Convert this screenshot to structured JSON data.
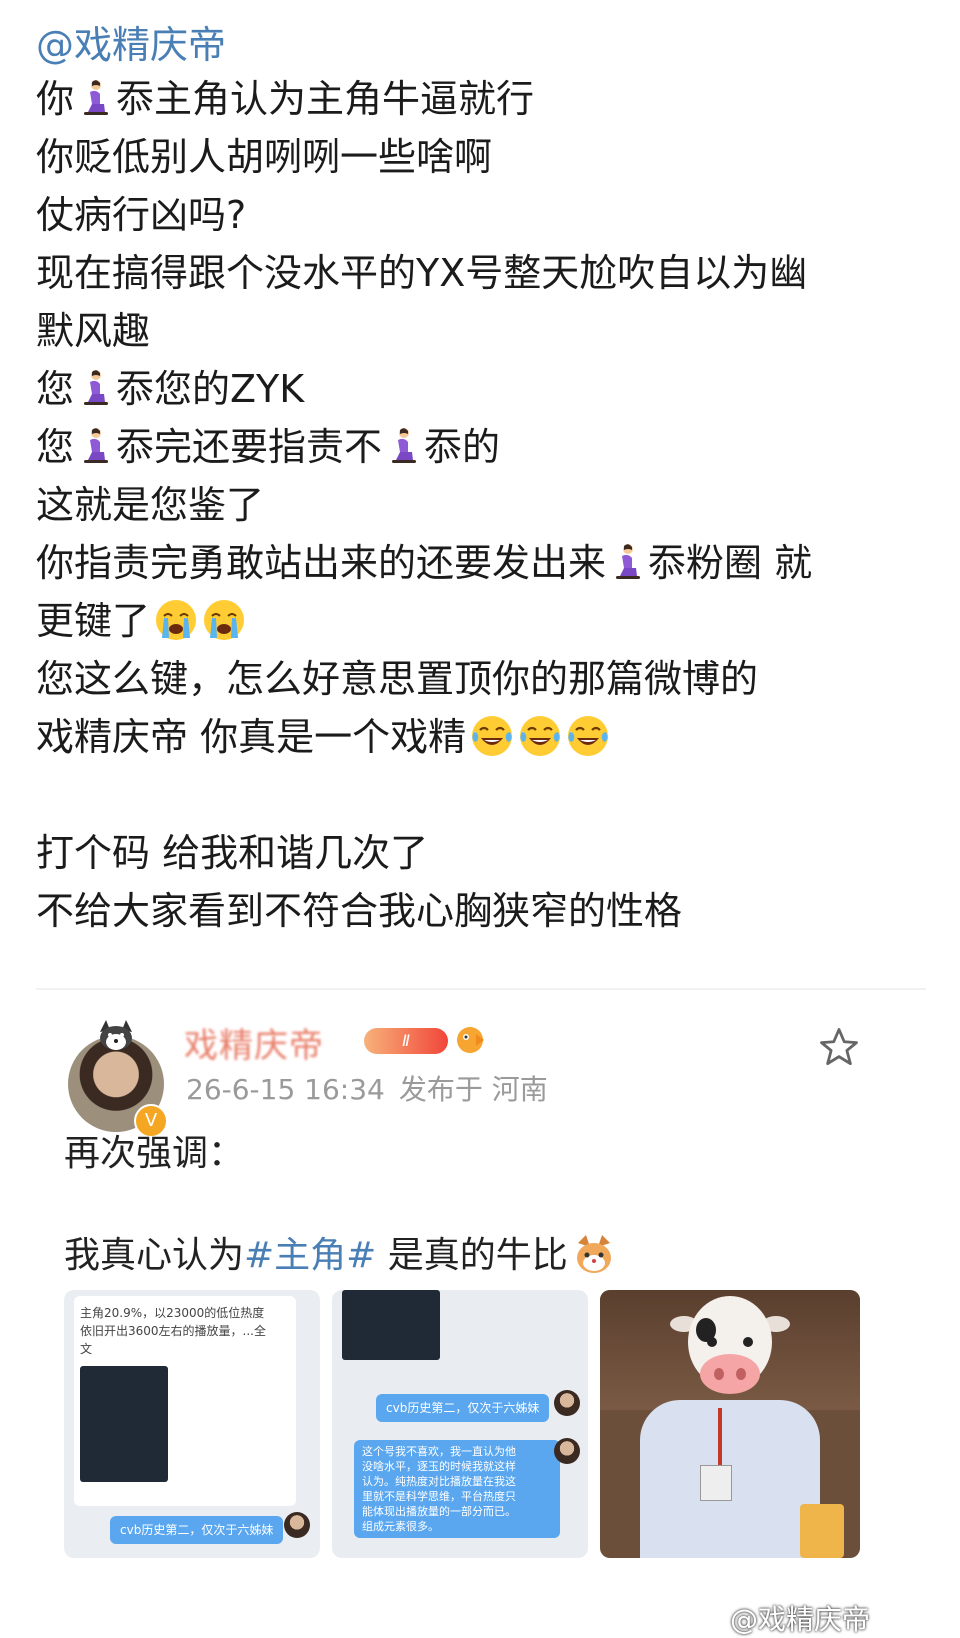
{
  "post": {
    "mention": "@戏精庆帝",
    "lines": [
      {
        "pre": "你",
        "emoji": "kneel",
        "post": "忝主角认为主角牛逼就行"
      },
      {
        "text": "你贬低别人胡咧咧一些啥啊"
      },
      {
        "text": "仗病行凶吗?"
      },
      {
        "text": "现在搞得跟个没水平的YX号整天尬吹自以为幽"
      },
      {
        "text": "默风趣"
      },
      {
        "pre": "您",
        "emoji": "kneel",
        "post": "忝您的ZYK"
      },
      {
        "pre": "您",
        "emoji": "kneel",
        "post": "忝完还要指责不",
        "emoji2": "kneel",
        "post2": "忝的"
      },
      {
        "text": "这就是您鉴了"
      },
      {
        "text": " 你指责完勇敢站出来的还要发出来",
        "emoji": "kneel",
        "post": "忝粉圈 就"
      },
      {
        "text": "更键了",
        "trail": "cry2"
      },
      {
        "text": " 您这么键，怎么好意思置顶你的那篇微博的"
      },
      {
        "text": " 戏精庆帝 你真是一个戏精",
        "trail": "laugh3"
      },
      {
        "text": ""
      },
      {
        "text": "打个码 给我和谐几次了"
      },
      {
        "text": "不给大家看到不符合我心胸狭窄的性格"
      }
    ]
  },
  "quoted": {
    "username": "戏精庆帝",
    "vip_label": "Ⅱ",
    "timestamp": "26-6-15 16:34",
    "location": "发布于 河南",
    "text1": "再次强调：",
    "text2_pre": "我真心认为",
    "text2_tag": "#主角#",
    "text2_post": " 是真的牛比",
    "thumb1": {
      "line1": "主角20.9%，以23000的低位热度",
      "line2": "依旧开出3600左右的播放量，...全",
      "line3": "文",
      "bubble": "cvb历史第二，仅次于六姊妹"
    },
    "thumb2": {
      "bubble1": "cvb历史第二，仅次于六姊妹",
      "bubble2_lines": [
        "这个号我不喜欢，我一直认为他",
        "没啥水平，逐玉的时候我就这样",
        "认为。纯热度对比播放量在我这",
        "里就不是科学思维，平台热度只",
        "能体现出播放量的一部分而已。",
        "组成元素很多。"
      ]
    }
  },
  "watermark": "@戏精庆帝",
  "colors": {
    "link": "#4a7fb5",
    "meta": "#9a9a9a",
    "name": "#e2553a"
  }
}
